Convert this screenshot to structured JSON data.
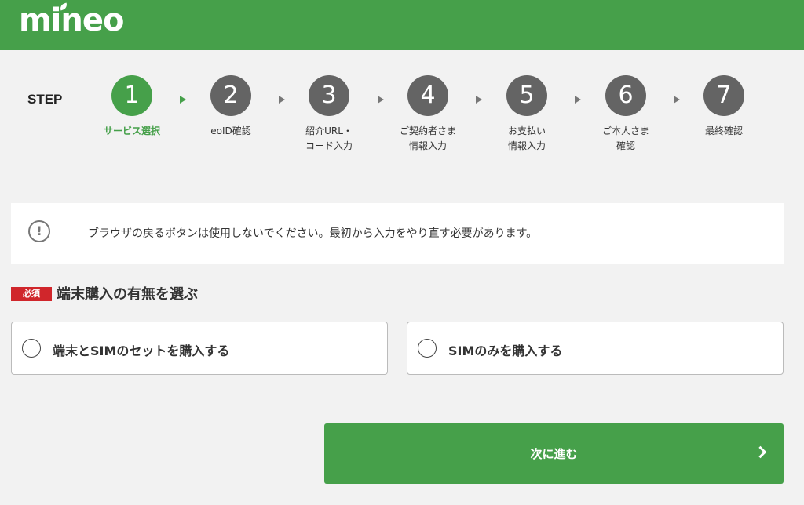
{
  "header": {
    "logo_text": "mineo",
    "brand_color": "#46a04a"
  },
  "progress": {
    "label": "STEP",
    "current_step": 1,
    "steps": [
      {
        "number": "1",
        "name": "サービス選択"
      },
      {
        "number": "2",
        "name": "eoID確認"
      },
      {
        "number": "3",
        "name": "紹介URL・\nコード入力"
      },
      {
        "number": "4",
        "name": "ご契約者さま\n情報入力"
      },
      {
        "number": "5",
        "name": "お支払い\n情報入力"
      },
      {
        "number": "6",
        "name": "ご本人さま\n確認"
      },
      {
        "number": "7",
        "name": "最終確認"
      }
    ]
  },
  "notice": {
    "icon": "exclamation-circle-icon",
    "text": "ブラウザの戻るボタンは使用しないでください。最初から入力をやり直す必要があります。"
  },
  "device_section": {
    "required_badge": "必須",
    "title": "端末購入の有無を選ぶ",
    "options": [
      {
        "label": "端末とSIMのセットを購入する",
        "selected": false
      },
      {
        "label": "SIMのみを購入する",
        "selected": false
      }
    ]
  },
  "next_button": {
    "label": "次に進む",
    "icon": "chevron-right-icon"
  }
}
